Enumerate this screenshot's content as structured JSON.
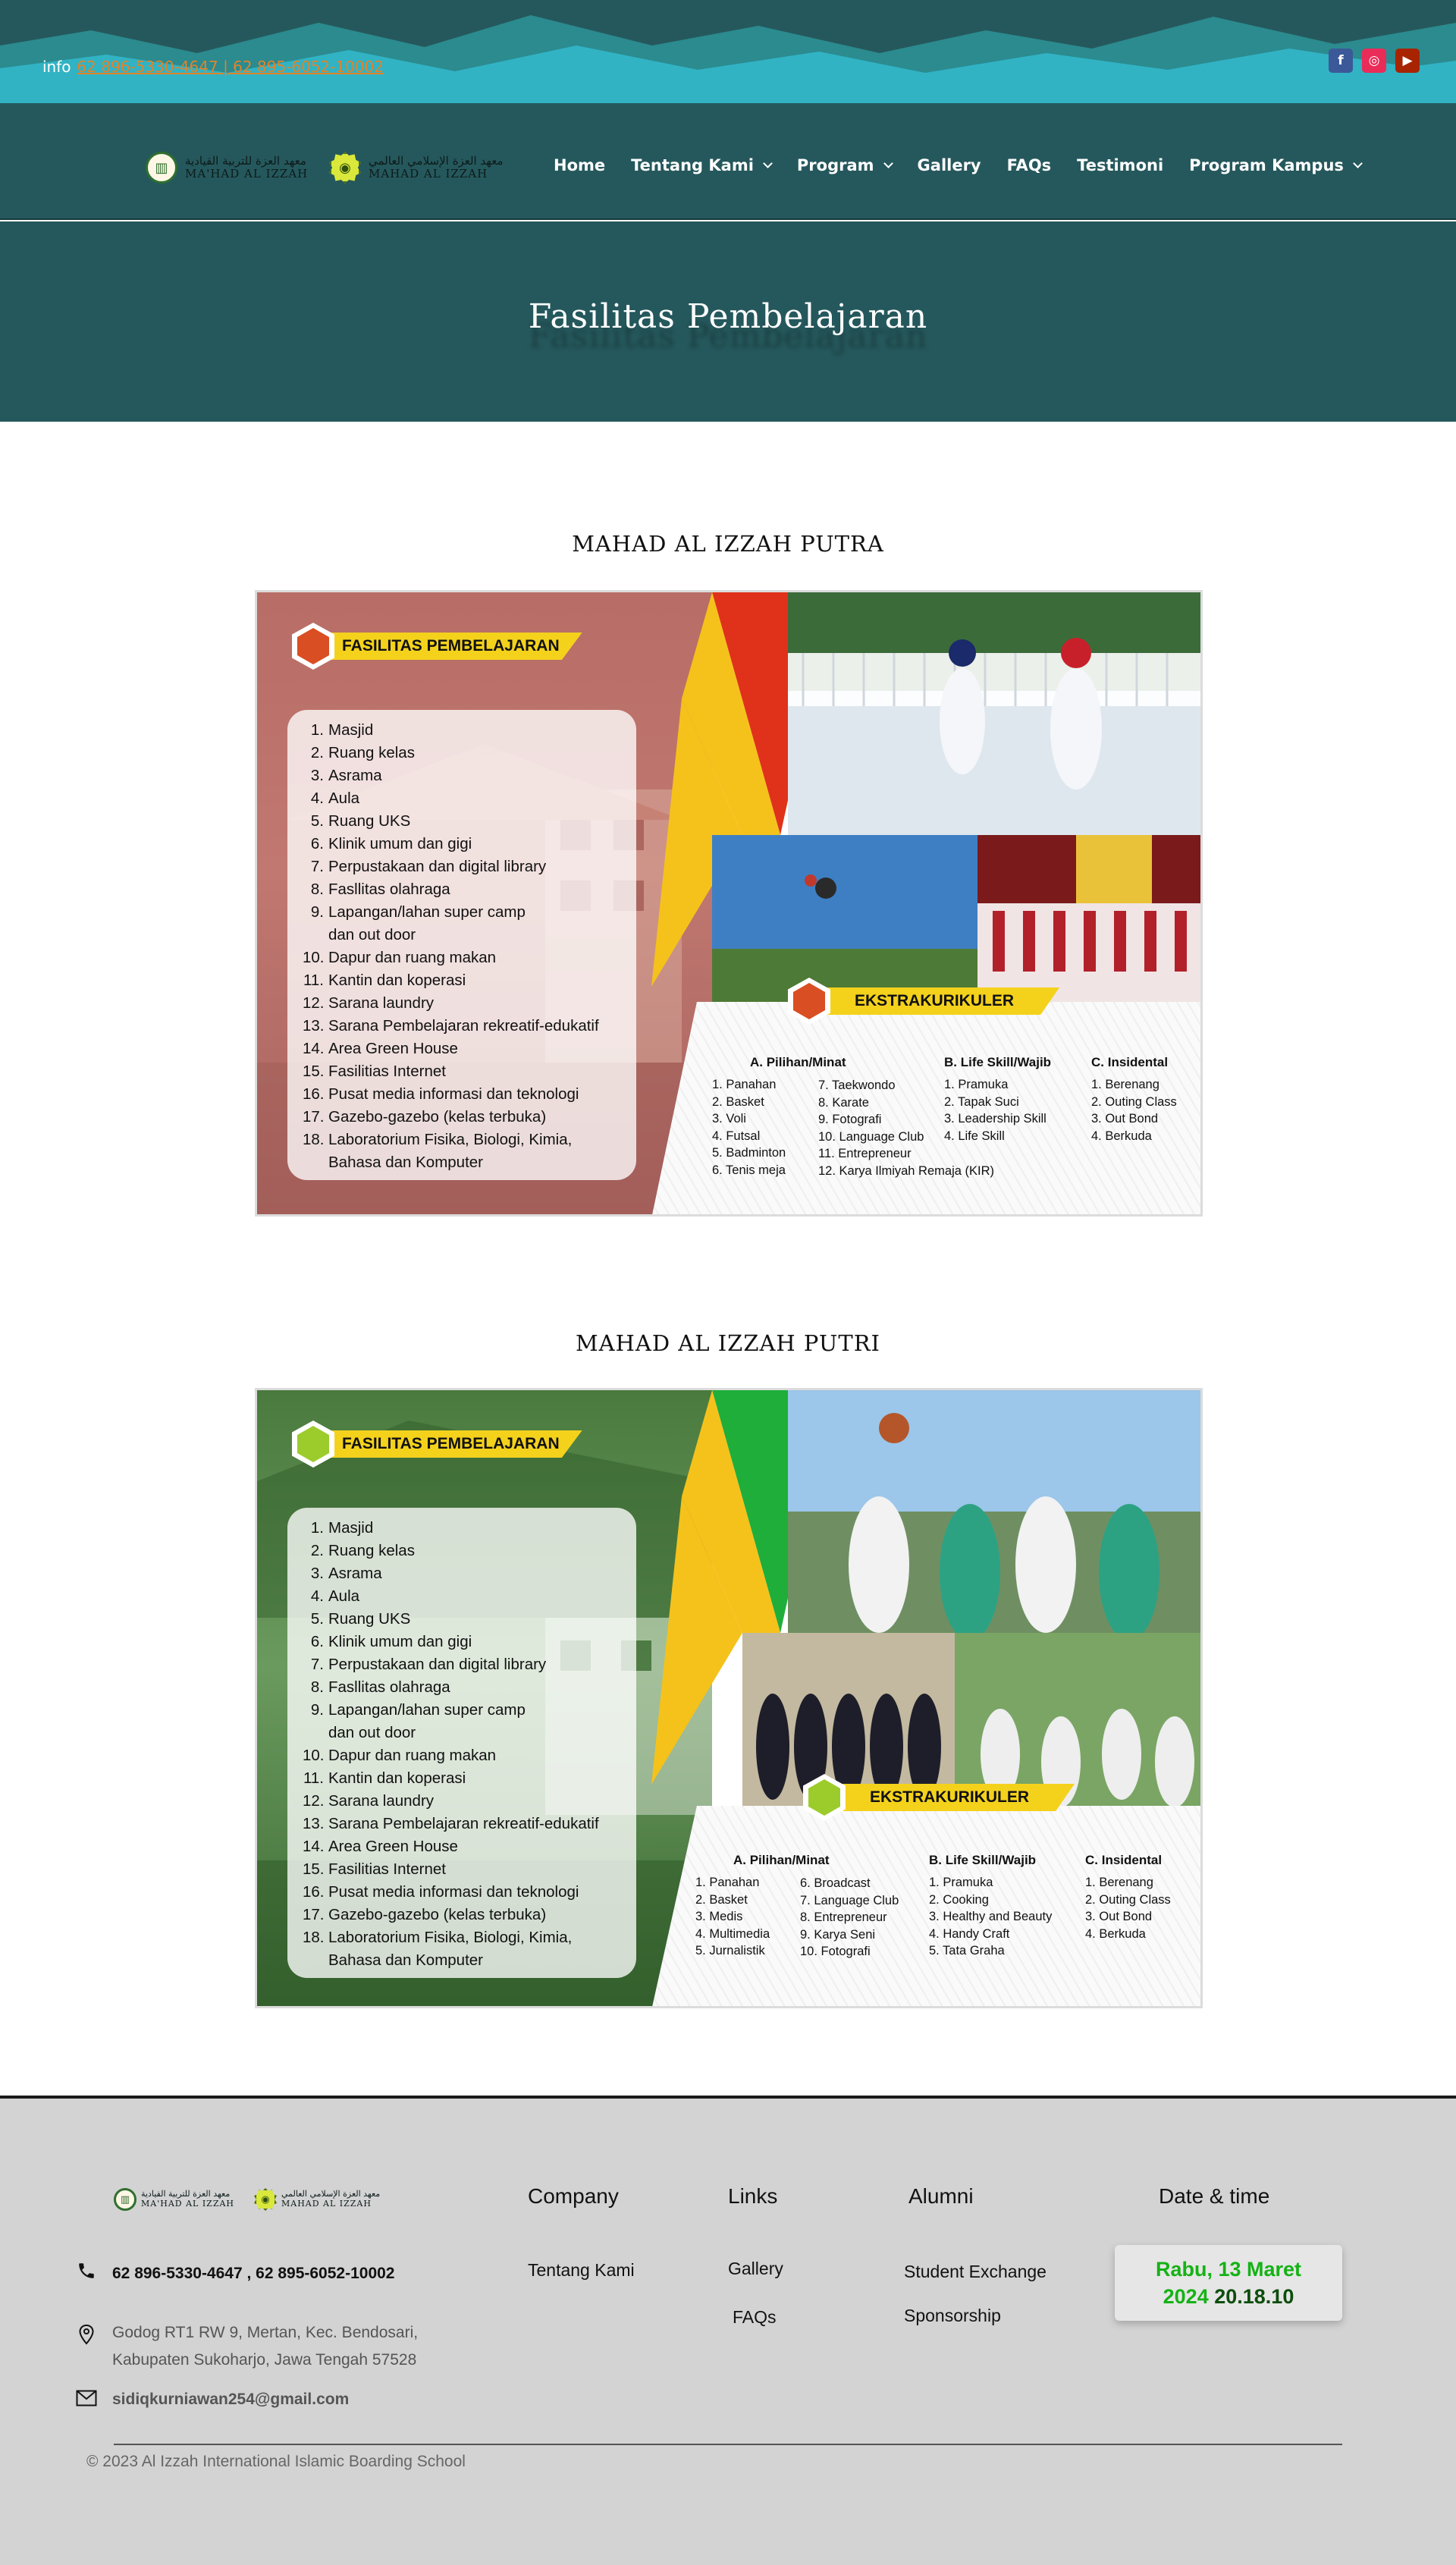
{
  "topbar": {
    "info_label": "info",
    "info_link": "62 896-5330-4647 | 62 895-6052-10002",
    "social": [
      {
        "name": "facebook",
        "glyph": "f"
      },
      {
        "name": "instagram",
        "glyph": "◎"
      },
      {
        "name": "youtube",
        "glyph": "▶"
      }
    ]
  },
  "header": {
    "logo1": {
      "arabic": "معهد العزة للتربية القيادية",
      "latin": "MA'HAD AL IZZAH"
    },
    "logo2": {
      "arabic": "معهد العزة الإسلامي العالمي",
      "latin": "MAHAD AL IZZAH"
    },
    "menu": [
      {
        "label": "Home",
        "dropdown": false
      },
      {
        "label": "Tentang Kami",
        "dropdown": true
      },
      {
        "label": "Program",
        "dropdown": true
      },
      {
        "label": "Gallery",
        "dropdown": false
      },
      {
        "label": "FAQs",
        "dropdown": false
      },
      {
        "label": "Testimoni",
        "dropdown": false
      },
      {
        "label": "Program Kampus",
        "dropdown": true
      }
    ]
  },
  "hero": {
    "title": "Fasilitas Pembelajaran"
  },
  "sections": [
    {
      "title": "MAHAD AL IZZAH PUTRA",
      "accent": "#c8452c",
      "banner_title": "FASILITAS PEMBELAJARAN",
      "facilities": [
        "Masjid",
        "Ruang kelas",
        "Asrama",
        "Aula",
        "Ruang UKS",
        "Klinik umum dan gigi",
        "Perpustakaan dan digital library",
        "Fasllitas olahraga",
        "Lapangan/lahan super camp",
        "dan out door",
        "Dapur dan ruang makan",
        "Kantin dan koperasi",
        "Sarana laundry",
        "Sarana Pembelajaran rekreatif-edukatif",
        "Area Green House",
        "Fasilitias Internet",
        "Pusat media informasi dan teknologi",
        "Gazebo-gazebo (kelas terbuka)",
        "Laboratorium Fisika, Biologi, Kimia,",
        "Bahasa dan Komputer"
      ],
      "ekstra_title": "EKSTRAKURIKULER",
      "columns": [
        {
          "heading": "A.  Pilihan/Minat",
          "items": [
            "1. Panahan",
            "2. Basket",
            "3. Voli",
            "4. Futsal",
            "5. Badminton",
            "6. Tenis meja"
          ]
        },
        {
          "heading": "",
          "items": [
            "7. Taekwondo",
            "8. Karate",
            "9. Fotografi",
            "10. Language Club",
            "11. Entrepreneur",
            "12. Karya Ilmiyah Remaja (KIR)"
          ]
        },
        {
          "heading": "B. Life Skill/Wajib",
          "items": [
            "1. Pramuka",
            "2. Tapak Suci",
            "3. Leadership Skill",
            "4. Life Skill"
          ]
        },
        {
          "heading": "C. Insidental",
          "items": [
            "1. Berenang",
            "2. Outing Class",
            "3. Out Bond",
            "4. Berkuda"
          ]
        }
      ]
    },
    {
      "title": "MAHAD AL IZZAH PUTRI",
      "accent": "#9ccc2c",
      "banner_title": "FASILITAS PEMBELAJARAN",
      "facilities": [
        "Masjid",
        "Ruang kelas",
        "Asrama",
        "Aula",
        "Ruang UKS",
        "Klinik umum dan gigi",
        "Perpustakaan dan digital library",
        "Fasllitas olahraga",
        "Lapangan/lahan super camp",
        "dan out door",
        "Dapur dan ruang makan",
        "Kantin dan koperasi",
        "Sarana laundry",
        "Sarana Pembelajaran rekreatif-edukatif",
        "Area Green House",
        "Fasilitias Internet",
        "Pusat media informasi dan teknologi",
        "Gazebo-gazebo (kelas terbuka)",
        "Laboratorium Fisika, Biologi, Kimia,",
        "Bahasa dan Komputer"
      ],
      "ekstra_title": "EKSTRAKURIKULER",
      "columns": [
        {
          "heading": "A.  Pilihan/Minat",
          "items": [
            "1. Panahan",
            "2. Basket",
            "3. Medis",
            "4. Multimedia",
            "5. Jurnalistik"
          ]
        },
        {
          "heading": "",
          "items": [
            "6. Broadcast",
            "7. Language Club",
            "8. Entrepreneur",
            "9. Karya Seni",
            "10. Fotografi"
          ]
        },
        {
          "heading": "B. Life Skill/Wajib",
          "items": [
            "1. Pramuka",
            "2. Cooking",
            "3. Healthy and Beauty",
            "4. Handy Craft",
            "5. Tata Graha"
          ]
        },
        {
          "heading": "C. Insidental",
          "items": [
            "1. Berenang",
            "2. Outing Class",
            "3. Out Bond",
            "4. Berkuda"
          ]
        }
      ]
    }
  ],
  "footer": {
    "phone": "62 896-5330-4647 , 62 895-6052-10002",
    "address_line1": "Godog RT1 RW 9, Mertan, Kec. Bendosari,",
    "address_line2": "Kabupaten Sukoharjo, Jawa Tengah 57528",
    "email": "sidiqkurniawan254@gmail.com",
    "company_heading": "Company",
    "company_links": [
      "Tentang Kami"
    ],
    "links_heading": "Links",
    "links": [
      "Gallery",
      "FAQs"
    ],
    "alumni_heading": "Alumni",
    "alumni_links": [
      "Student Exchange",
      "Sponsorship"
    ],
    "datetime_heading": "Date & time",
    "date": "Rabu, 13 Maret",
    "year": "2024",
    "time": "20.18.10",
    "copyright": "© 2023 Al Izzah International Islamic Boarding School"
  }
}
